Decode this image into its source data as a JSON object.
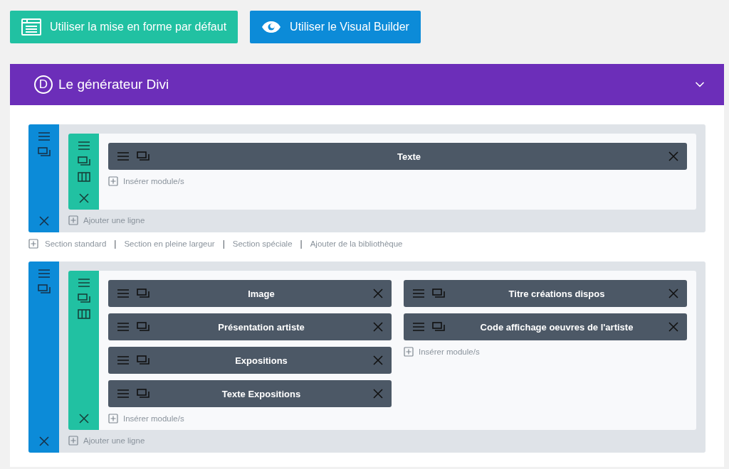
{
  "top_buttons": [
    {
      "kind": "layout",
      "label": "Utiliser la mise en forme par défaut"
    },
    {
      "kind": "visual",
      "label": "Utiliser le Visual Builder"
    }
  ],
  "builder": {
    "logo": "D",
    "title": "Le générateur Divi",
    "expanded": true,
    "sections": [
      {
        "rows": [
          {
            "columns": [
              {
                "modules": [
                  "Texte"
                ],
                "insert_label": "Insérer module/s"
              }
            ]
          }
        ],
        "add_row_label": "Ajouter une ligne",
        "add_section_links": [
          {
            "kind": "link",
            "label": "Section standard"
          },
          {
            "kind": "separator",
            "label": "|"
          },
          {
            "kind": "link",
            "label": "Section en pleine largeur"
          },
          {
            "kind": "separator",
            "label": "|"
          },
          {
            "kind": "link",
            "label": "Section spéciale"
          },
          {
            "kind": "separator",
            "label": "|"
          },
          {
            "kind": "link",
            "label": "Ajouter de la bibliothèque"
          }
        ]
      },
      {
        "rows": [
          {
            "columns": [
              {
                "modules": [
                  "Image",
                  "Présentation artiste",
                  "Expositions",
                  "Texte Expositions"
                ],
                "insert_label": "Insérer module/s"
              },
              {
                "modules": [
                  "Titre créations dispos",
                  "Code affichage oeuvres de l'artiste"
                ],
                "insert_label": "Insérer module/s"
              }
            ]
          }
        ],
        "add_row_label": "Ajouter une ligne"
      }
    ]
  }
}
